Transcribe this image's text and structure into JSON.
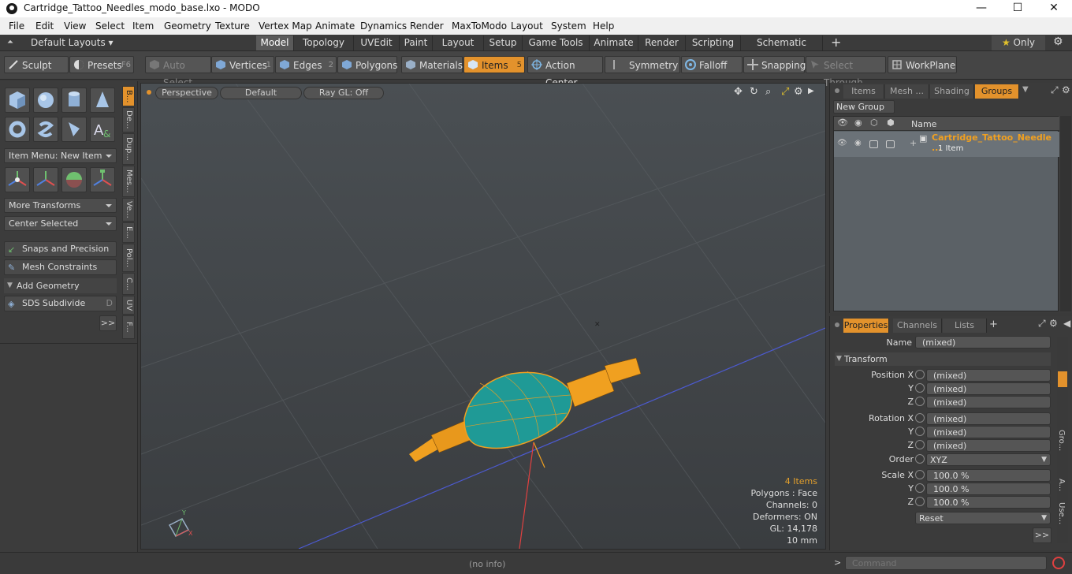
{
  "window": {
    "title": "Cartridge_Tattoo_Needles_modo_base.lxo - MODO",
    "minimize": "—",
    "maximize": "☐",
    "close": "✕"
  },
  "menu": [
    "File",
    "Edit",
    "View",
    "Select",
    "Item",
    "Geometry",
    "Texture",
    "Vertex Map",
    "Animate",
    "Dynamics",
    "Render",
    "MaxToModo",
    "Layout",
    "System",
    "Help"
  ],
  "layouts": {
    "default_layouts": "Default Layouts",
    "tabs": [
      "Model",
      "Topology",
      "UVEdit",
      "Paint",
      "Layout",
      "Setup",
      "Game Tools",
      "Animate",
      "Render",
      "Scripting",
      "Schematic Fusion"
    ],
    "active_tab": "Model",
    "add": "+",
    "only": "Only"
  },
  "toolbar": {
    "sculpt": "Sculpt",
    "presets": "Presets",
    "presets_key": "F6",
    "auto_select": "Auto Select",
    "vertices": "Vertices",
    "vertices_num": "1",
    "edges": "Edges",
    "edges_num": "2",
    "polygons": "Polygons",
    "materials": "Materials",
    "items": "Items",
    "items_num": "5",
    "action_center": "Action Center",
    "symmetry": "Symmetry",
    "falloff": "Falloff",
    "snapping": "Snapping",
    "select_through": "Select Through",
    "workplane": "WorkPlane"
  },
  "left": {
    "item_menu": "Item Menu: New Item",
    "more_transforms": "More Transforms",
    "center_selected": "Center Selected",
    "snaps": "Snaps and Precision",
    "mesh_constraints": "Mesh Constraints",
    "add_geometry": "Add Geometry",
    "sds": "SDS Subdivide",
    "sds_key": "D",
    "more": ">>",
    "vtabs": [
      "B...",
      "De...",
      "Dup...",
      "Mes...",
      "Ve...",
      "E...",
      "Pol...",
      "C...",
      "UV",
      "F..."
    ]
  },
  "viewport": {
    "perspective": "Perspective",
    "default": "Default",
    "raygl": "Ray GL: Off",
    "stats": {
      "items": "4 Items",
      "polygons": "Polygons : Face",
      "channels": "Channels: 0",
      "deformers": "Deformers: ON",
      "gl": "GL: 14,178",
      "unit": "10 mm"
    },
    "axis_y": "Y",
    "axis_x": "X"
  },
  "groups": {
    "tabs": [
      "Items",
      "Mesh ...",
      "Shading",
      "Groups"
    ],
    "active_tab": "Groups",
    "new_group": "New Group",
    "col_name": "Name",
    "item_name": "Cartridge_Tattoo_Needle ...",
    "item_count": "1 Item"
  },
  "properties": {
    "tabs": [
      "Properties",
      "Channels",
      "Lists"
    ],
    "add": "+",
    "name_label": "Name",
    "name_value": "(mixed)",
    "transform": "Transform",
    "position_x": "Position X",
    "rotation_x": "Rotation X",
    "scale_x": "Scale X",
    "y": "Y",
    "z": "Z",
    "mixed": "(mixed)",
    "order_label": "Order",
    "order_value": "XYZ",
    "scale_value": "100.0 %",
    "reset": "Reset",
    "more": ">>",
    "side_tabs": [
      "Gro...",
      "A...",
      "Use..."
    ]
  },
  "status": {
    "info": "(no info)",
    "command_placeholder": "Command",
    "prompt": ">"
  },
  "colors": {
    "accent": "#e3922c",
    "mesh_fill": "#1f9a96",
    "wire": "#f0a020"
  }
}
